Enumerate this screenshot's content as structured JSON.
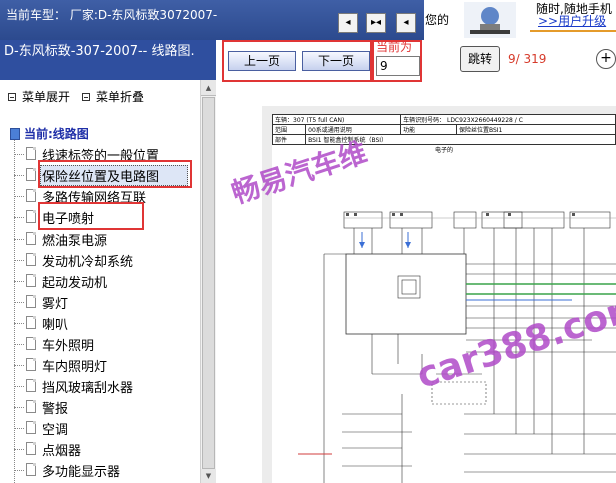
{
  "topbar": {
    "current_car": "当前车型：  厂家:D-东风标致3072007-",
    "buttons": [
      {
        "icon": "nav-prev-icon",
        "glyph": "◂"
      },
      {
        "icon": "nav-center-icon",
        "glyph": "▸◂"
      },
      {
        "icon": "nav-next-icon",
        "glyph": "◂"
      }
    ],
    "ad": {
      "left_text": "您的",
      "top_text": "随时,随地手机",
      "link": ">>用户升级"
    }
  },
  "left_panel": {
    "header": "D-东风标致-307-2007-- 线路图.",
    "expand_label": "菜单展开",
    "collapse_label": "菜单折叠",
    "tree_title": "当前:线路图",
    "items": [
      {
        "label": "线速标签的一般位置"
      },
      {
        "label": "保险丝位置及电路图"
      },
      {
        "label": "多路传输网络互联"
      },
      {
        "label": "电子喷射"
      },
      {
        "label": "燃油泵电源"
      },
      {
        "label": "发动机冷却系统"
      },
      {
        "label": "起动发动机"
      },
      {
        "label": "雾灯"
      },
      {
        "label": "喇叭"
      },
      {
        "label": "车外照明"
      },
      {
        "label": "车内照明灯"
      },
      {
        "label": "挡风玻璃刮水器"
      },
      {
        "label": "警报"
      },
      {
        "label": "空调"
      },
      {
        "label": "点烟器"
      },
      {
        "label": "多功能显示器"
      }
    ]
  },
  "toolbar": {
    "prev_label": "上一页",
    "next_label": "下一页",
    "page_label": "当前为",
    "page_value": "9",
    "jump_label": "跳转",
    "page_count": "9/ 319",
    "zoom_label": "+"
  },
  "document": {
    "header_rows": [
      [
        "车辆：307 (T5 full CAN)",
        "车辆识别号码：  LDC923X2660449228 / C"
      ],
      [
        "范围",
        "00系或通用说明",
        "功能",
        "保险丝位置BSI1"
      ],
      [
        "部件",
        "BSI1 智能盒控制系统（BSI）",
        "",
        ""
      ]
    ],
    "subtitle": "电子的",
    "watermark_cn": "畅易汽车维",
    "watermark_url": "car388.com"
  },
  "colors": {
    "header_bg": "#2f4f9f",
    "highlight": "#e03535",
    "watermark": "#b04bc8",
    "page_count": "#d63a2a",
    "link": "#1a3bc9"
  }
}
